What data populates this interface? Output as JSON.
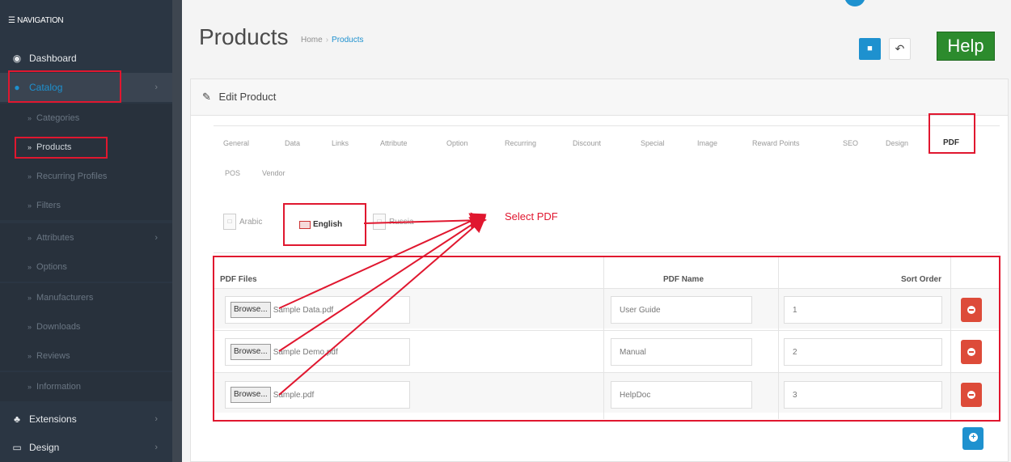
{
  "sidebar": {
    "heading": "NAVIGATION",
    "items": [
      {
        "label": "Dashboard",
        "icon": "dashboard-icon"
      },
      {
        "label": "Catalog",
        "icon": "tag-icon"
      },
      {
        "label": "Extensions",
        "icon": "puzzle-icon"
      },
      {
        "label": "Design",
        "icon": "monitor-icon"
      }
    ],
    "catalog_subitems": [
      "Categories",
      "Products",
      "Recurring Profiles",
      "Filters",
      "Attributes",
      "Options",
      "Manufacturers",
      "Downloads",
      "Reviews",
      "Information"
    ]
  },
  "header": {
    "title": "Products",
    "breadcrumb": [
      "Home",
      "Products"
    ],
    "save_icon": "save-icon",
    "back_icon": "reply-icon",
    "help_label": "Help"
  },
  "panel": {
    "title": "Edit Product",
    "tabs": [
      "General",
      "Data",
      "Links",
      "Attribute",
      "Option",
      "Recurring",
      "Discount",
      "Special",
      "Image",
      "Reward Points",
      "SEO",
      "Design",
      "PDF",
      "POS",
      "Vendor"
    ],
    "active_tab": "PDF",
    "languages": [
      "Arabic",
      "English",
      "Russia"
    ],
    "active_language": "English",
    "annotation": "Select PDF",
    "table": {
      "headers": [
        "PDF Files",
        "PDF Name",
        "Sort Order"
      ],
      "browse_label": "Browse...",
      "rows": [
        {
          "file": "Sample Data.pdf",
          "name": "User Guide",
          "sort": "1"
        },
        {
          "file": "Sample Demo.pdf",
          "name": "Manual",
          "sort": "2"
        },
        {
          "file": "Sample.pdf",
          "name": "HelpDoc",
          "sort": "3"
        }
      ]
    }
  },
  "colors": {
    "sidebar_bg": "#2b3643",
    "accent_blue": "#1e91cf",
    "help_green": "#2c8b2d",
    "delete_red": "#dd4b39",
    "annotation_red": "#e0172f"
  }
}
